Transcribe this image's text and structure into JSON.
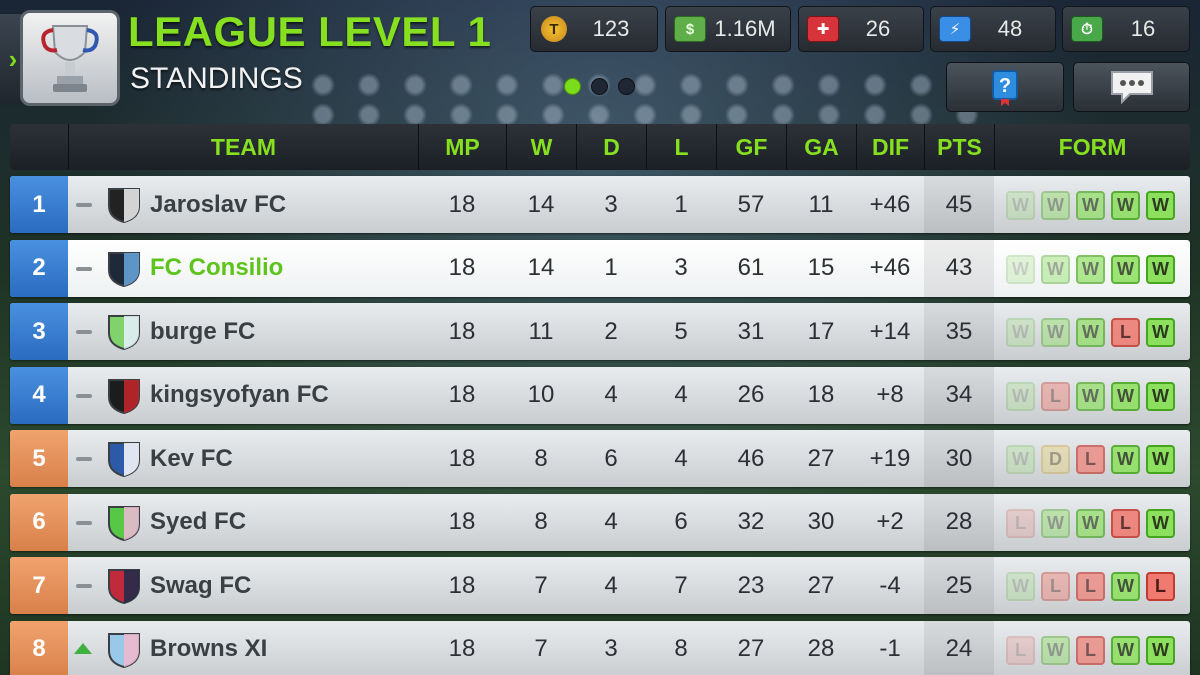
{
  "header": {
    "title": "LEAGUE LEVEL 1",
    "subtitle": "STANDINGS",
    "page_dots": 3,
    "active_dot": 0
  },
  "resources": {
    "tokens": "123",
    "cash": "1.16M",
    "health": "26",
    "energy": "48",
    "training": "16"
  },
  "table": {
    "columns": {
      "team": "TEAM",
      "mp": "MP",
      "w": "W",
      "d": "D",
      "l": "L",
      "gf": "GF",
      "ga": "GA",
      "dif": "DIF",
      "pts": "PTS",
      "form": "FORM"
    },
    "rows": [
      {
        "pos": "1",
        "zone": "blue",
        "trend": "same",
        "team": "Jaroslav FC",
        "mp": "18",
        "w": "14",
        "d": "3",
        "l": "1",
        "gf": "57",
        "ga": "11",
        "dif": "+46",
        "pts": "45",
        "form": [
          "W",
          "W",
          "W",
          "W",
          "W"
        ],
        "crest": [
          "#222222",
          "#f2f2f2"
        ]
      },
      {
        "pos": "2",
        "zone": "blue",
        "trend": "same",
        "team": "FC Consilio",
        "mp": "18",
        "w": "14",
        "d": "1",
        "l": "3",
        "gf": "61",
        "ga": "15",
        "dif": "+46",
        "pts": "43",
        "form": [
          "W",
          "W",
          "W",
          "W",
          "W"
        ],
        "crest": [
          "#1e2a3a",
          "#6aa8e0"
        ],
        "highlight": true
      },
      {
        "pos": "3",
        "zone": "blue",
        "trend": "same",
        "team": "burge FC",
        "mp": "18",
        "w": "11",
        "d": "2",
        "l": "5",
        "gf": "31",
        "ga": "17",
        "dif": "+14",
        "pts": "35",
        "form": [
          "W",
          "W",
          "W",
          "L",
          "W"
        ],
        "crest": [
          "#7fd36a",
          "#e8f0ff"
        ]
      },
      {
        "pos": "4",
        "zone": "blue",
        "trend": "same",
        "team": "kingsyofyan FC",
        "mp": "18",
        "w": "10",
        "d": "4",
        "l": "4",
        "gf": "26",
        "ga": "18",
        "dif": "+8",
        "pts": "34",
        "form": [
          "W",
          "L",
          "W",
          "W",
          "W"
        ],
        "crest": [
          "#1c1c1c",
          "#c8262b"
        ]
      },
      {
        "pos": "5",
        "zone": "orange",
        "trend": "same",
        "team": "Kev FC",
        "mp": "18",
        "w": "8",
        "d": "6",
        "l": "4",
        "gf": "46",
        "ga": "27",
        "dif": "+19",
        "pts": "30",
        "form": [
          "W",
          "D",
          "L",
          "W",
          "W"
        ],
        "crest": [
          "#2d5aa8",
          "#ffffff"
        ]
      },
      {
        "pos": "6",
        "zone": "orange",
        "trend": "same",
        "team": "Syed FC",
        "mp": "18",
        "w": "8",
        "d": "4",
        "l": "6",
        "gf": "32",
        "ga": "30",
        "dif": "+2",
        "pts": "28",
        "form": [
          "L",
          "W",
          "W",
          "L",
          "W"
        ],
        "crest": [
          "#56c845",
          "#f0b8d8"
        ]
      },
      {
        "pos": "7",
        "zone": "orange",
        "trend": "same",
        "team": "Swag FC",
        "mp": "18",
        "w": "7",
        "d": "4",
        "l": "7",
        "gf": "23",
        "ga": "27",
        "dif": "-4",
        "pts": "25",
        "form": [
          "W",
          "L",
          "L",
          "W",
          "L"
        ],
        "crest": [
          "#c02a3a",
          "#1c2a4a"
        ]
      },
      {
        "pos": "8",
        "zone": "orange",
        "trend": "up",
        "team": "Browns XI",
        "mp": "18",
        "w": "7",
        "d": "3",
        "l": "8",
        "gf": "27",
        "ga": "28",
        "dif": "-1",
        "pts": "24",
        "form": [
          "L",
          "W",
          "L",
          "W",
          "W"
        ],
        "crest": [
          "#9ac8e8",
          "#f2b8cc"
        ]
      }
    ]
  }
}
